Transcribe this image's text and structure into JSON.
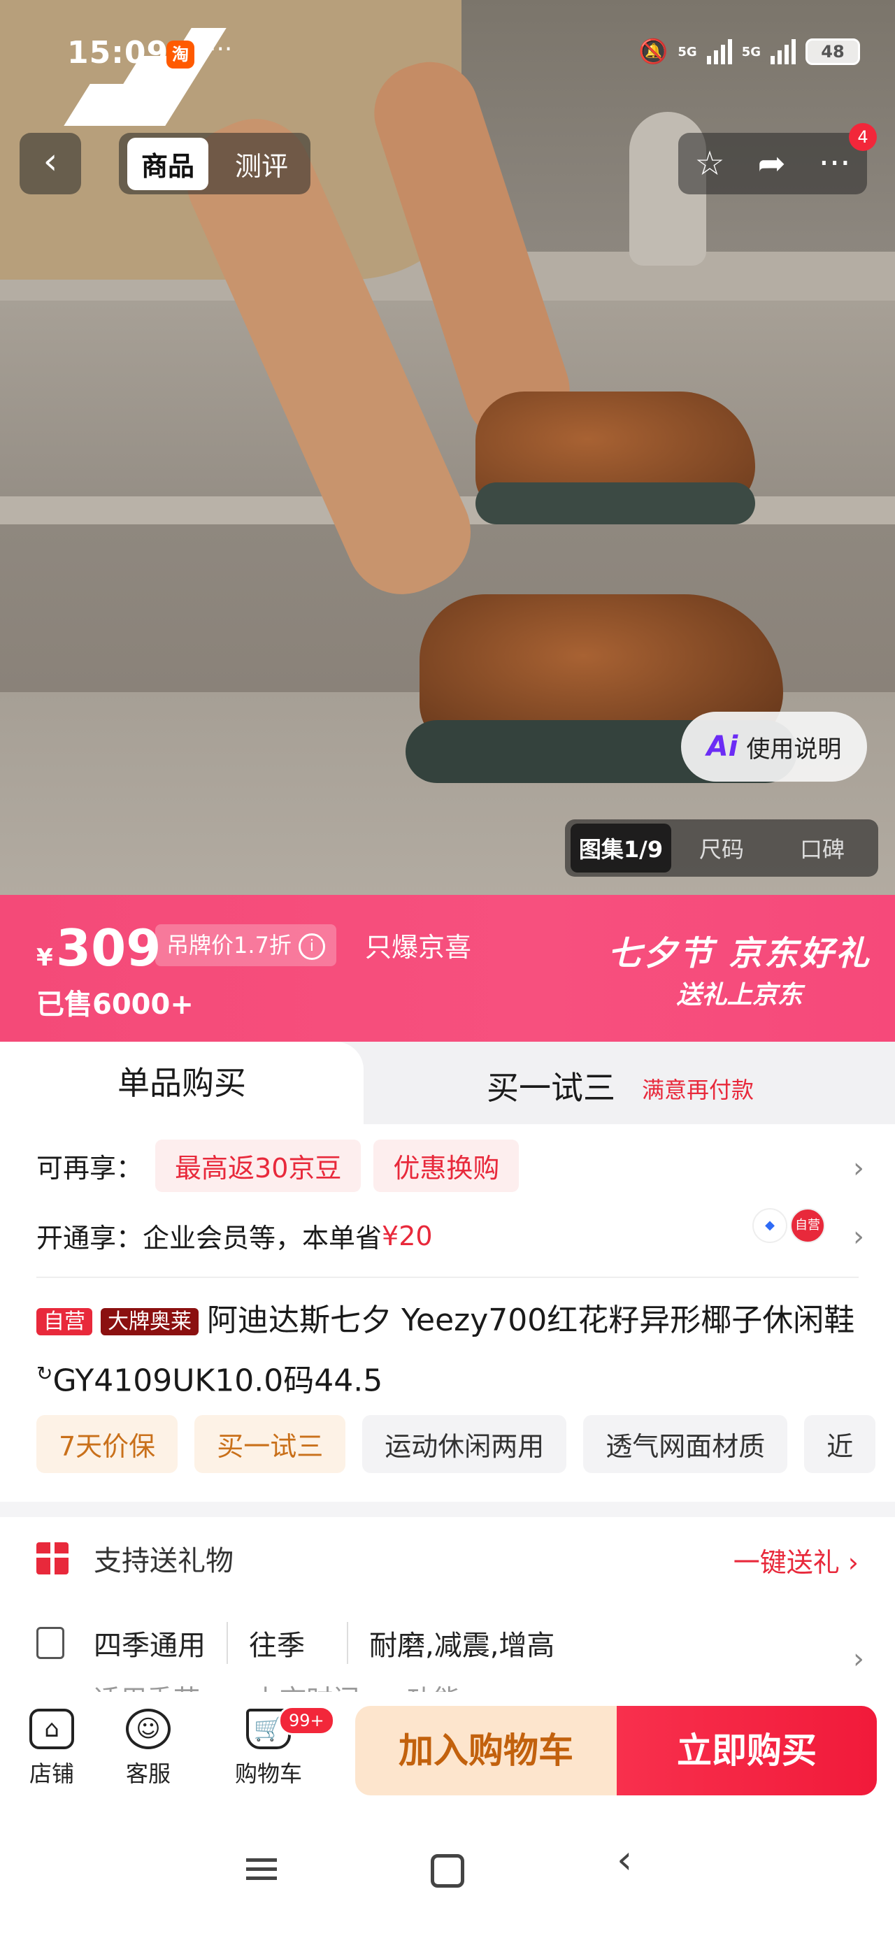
{
  "status_bar": {
    "time": "15:09",
    "app_badge": "淘",
    "more": "···",
    "signal1": "5G",
    "signal2": "5G",
    "battery": "48"
  },
  "top_nav": {
    "back": "‹",
    "tabs": [
      {
        "label": "商品"
      },
      {
        "label": "测评"
      }
    ],
    "actions_badge": "4"
  },
  "hero": {
    "ai_button": "使用说明",
    "ai_mark": "Ai",
    "gallery": [
      {
        "label": "图集1/9"
      },
      {
        "label": "尺码"
      },
      {
        "label": "口碑"
      }
    ]
  },
  "price_banner": {
    "currency": "¥",
    "price": "309",
    "tag_price": "吊牌价1.7折",
    "info": "i",
    "only": "只爆京喜",
    "sold": "已售6000+",
    "promo_line1": "七夕节 京东好礼",
    "promo_line2": "送礼上京东"
  },
  "buy_tabs": {
    "single": "单品购买",
    "trial": "买一试三",
    "trial_note": "满意再付款"
  },
  "benefits": {
    "row1_label": "可再享：",
    "row1_chips": [
      "最高返30京豆",
      "优惠换购"
    ],
    "row2_label": "开通享：",
    "row2_text": "企业会员等，本单省",
    "row2_amount": "¥20",
    "row2_icon_b": "自营"
  },
  "product": {
    "label_self": "自营",
    "label_brand": "大牌奥莱",
    "title": "阿迪达斯七夕 Yeezy700红花籽异形椰子休闲鞋",
    "title_suffix": "GY4109UK10.0码44.5",
    "tags": [
      "7天价保",
      "买一试三",
      "运动休闲两用",
      "透气网面材质",
      "近"
    ]
  },
  "gift": {
    "label": "支持送礼物",
    "link": "一键送礼 ›"
  },
  "specs": {
    "season": "四季通用",
    "season_sub": "适用季节",
    "launch": "往季",
    "launch_sub": "上市时间",
    "feature": "耐磨,减震,增高",
    "feature_sub": "功能"
  },
  "bottom_bar": {
    "store": "店铺",
    "service": "客服",
    "cart": "购物车",
    "cart_badge": "99+",
    "add_cart": "加入购物车",
    "buy_now": "立即购买"
  }
}
